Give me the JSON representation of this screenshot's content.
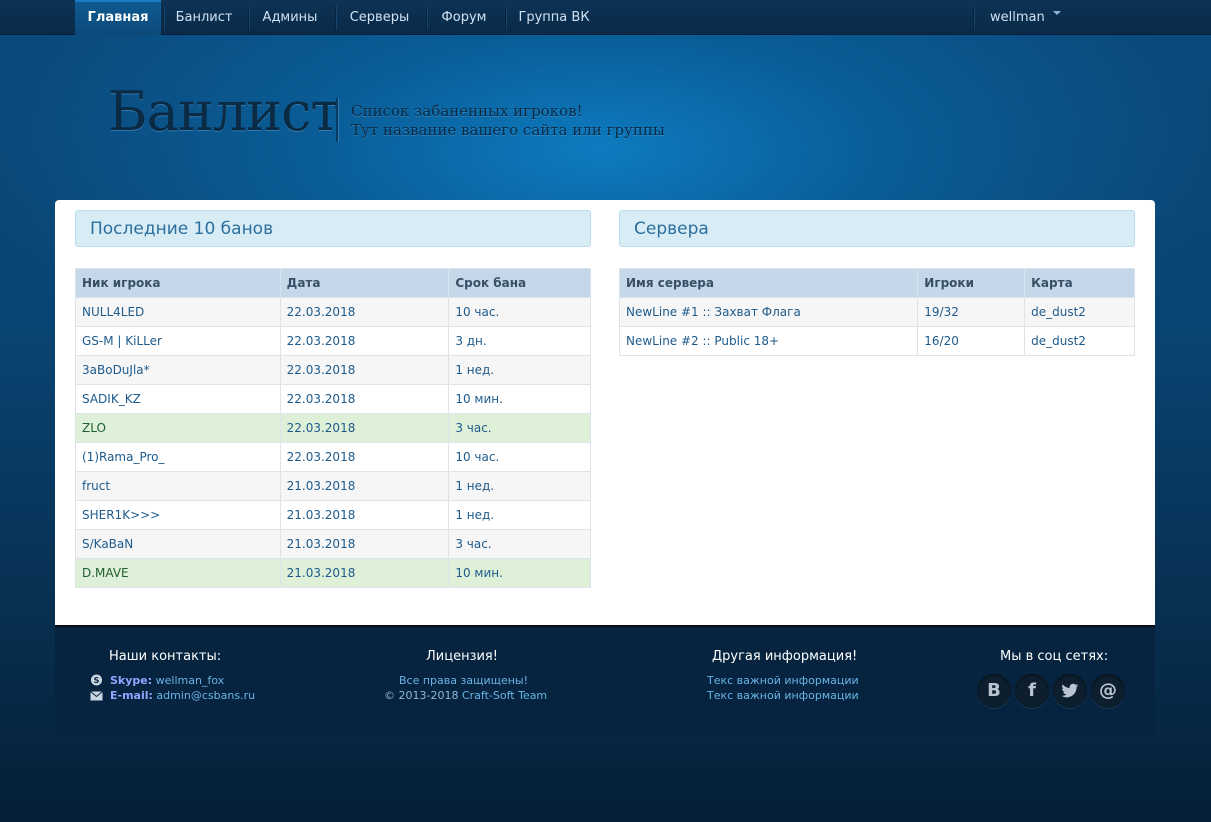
{
  "nav": {
    "items": [
      {
        "label": "Главная",
        "active": true
      },
      {
        "label": "Банлист"
      },
      {
        "label": "Админы"
      },
      {
        "label": "Серверы"
      },
      {
        "label": "Форум"
      },
      {
        "label": "Группа ВК"
      }
    ],
    "user": "wellman"
  },
  "header": {
    "logo": "Банлист",
    "tagline1": "Список забаненных игроков!",
    "tagline2": "Тут название вашего сайта или группы"
  },
  "bans": {
    "title": "Последние 10 банов",
    "columns": [
      "Ник игрока",
      "Дата",
      "Срок бана"
    ],
    "rows": [
      [
        "NULL4LED",
        "22.03.2018",
        "10 час."
      ],
      [
        "GS-M | KiLLer",
        "22.03.2018",
        "3 дн."
      ],
      [
        "3aBoDuJla*",
        "22.03.2018",
        "1 нед."
      ],
      [
        "SADIK_KZ",
        "22.03.2018",
        "10 мин."
      ],
      [
        "ZLO",
        "22.03.2018",
        "3 час."
      ],
      [
        "(1)Rama_Pro_",
        "22.03.2018",
        "10 час."
      ],
      [
        "fruct",
        "21.03.2018",
        "1 нед."
      ],
      [
        "SHER1K>>>",
        "21.03.2018",
        "1 нед."
      ],
      [
        "S/KaBaN",
        "21.03.2018",
        "3 час."
      ],
      [
        "D.MAVE",
        "21.03.2018",
        "10 мин."
      ]
    ]
  },
  "servers": {
    "title": "Сервера",
    "columns": [
      "Имя сервера",
      "Игроки",
      "Карта"
    ],
    "rows": [
      [
        "NewLine #1 :: Захват Флага",
        "19/32",
        "de_dust2"
      ],
      [
        "NewLine #2 :: Public 18+",
        "16/20",
        "de_dust2"
      ]
    ]
  },
  "footer": {
    "contacts": {
      "title": "Наши контакты:",
      "skype_label": "Skype:",
      "skype": "wellman_fox",
      "email_label": "E-mail:",
      "email": "admin@csbans.ru"
    },
    "license": {
      "title": "Лицензия!",
      "line1": "Все права защищены!",
      "line2_prefix": "© 2013-2018",
      "line2_link": "Craft-Soft Team"
    },
    "other": {
      "title": "Другая информация!",
      "line1": "Текс важной информации",
      "line2": "Текс важной информации"
    },
    "social": {
      "title": "Мы в соц сетях:",
      "icons": [
        "vk-icon",
        "facebook-icon",
        "twitter-icon",
        "email-icon"
      ]
    }
  }
}
